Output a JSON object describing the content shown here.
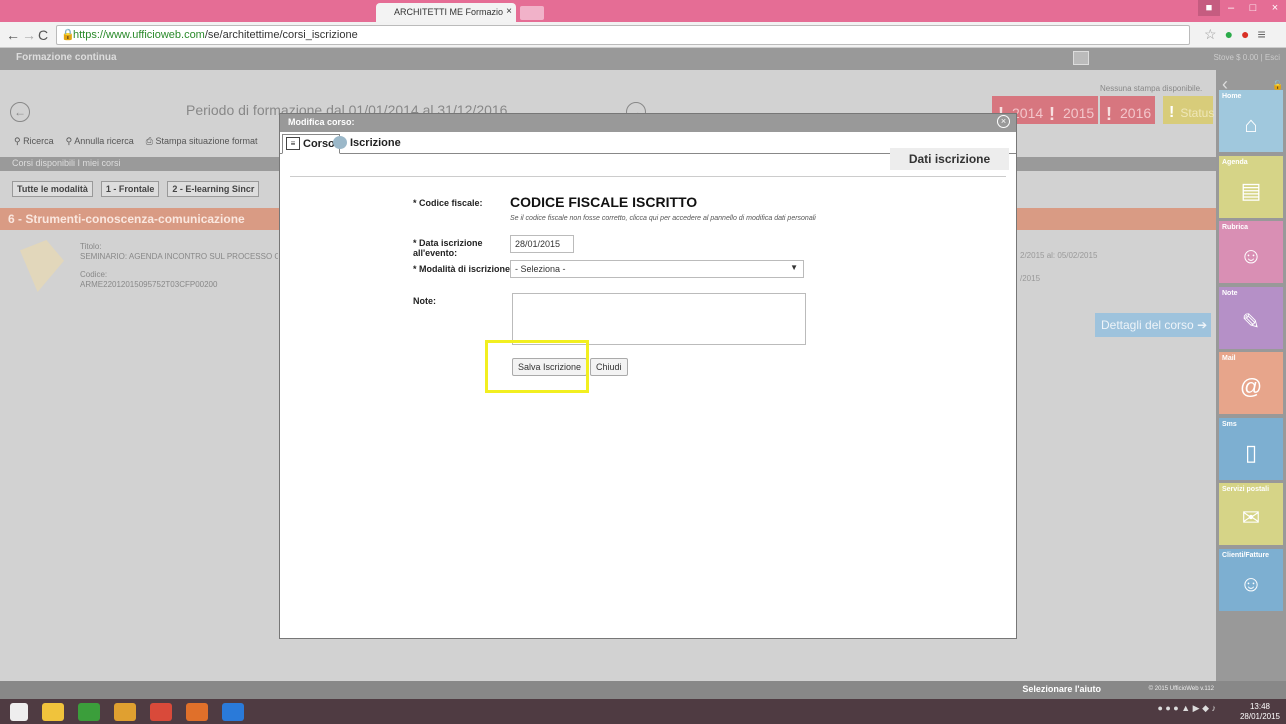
{
  "browser": {
    "tab_title": "ARCHITETTI ME Formazio",
    "url_host": "https://www.ufficioweb.com",
    "url_path": "/se/architettime/corsi_iscrizione"
  },
  "app": {
    "title": "Formazione continua",
    "top_right": "Stove $ 0.00 | Esci",
    "period": "Periodo di formazione dal 01/01/2014 al 31/12/2016",
    "no_print": "Nessuna stampa disponibile.",
    "years": [
      "2014",
      "2015",
      "2016"
    ],
    "status": "Status",
    "toolbar": [
      "Ricerca",
      "Annulla ricerca",
      "Stampa situazione format"
    ],
    "tabs_row": "Corsi disponibili  I miei corsi",
    "modalities": [
      "Tutte le modalità",
      "1 - Frontale",
      "2 - E-learning Sincr"
    ],
    "category": "6 - Strumenti-conoscenza-comunicazione",
    "course": {
      "titolo_label": "Titolo:",
      "titolo": "SEMINARIO: AGENDA INCONTRO SUL PROCESSO CIVILE",
      "codice_label": "Codice:",
      "codice": "ARME22012015095752T03CFP00200"
    },
    "right_info": [
      "2/2015 al: 05/02/2015",
      "/2015"
    ],
    "dettagli": "Dettagli del corso"
  },
  "sidebar": {
    "tiles": [
      {
        "label": "Home",
        "icon": "home-icon",
        "color": "#a0c8dd"
      },
      {
        "label": "Agenda",
        "icon": "agenda-icon",
        "color": "#d6d487"
      },
      {
        "label": "Rubrica",
        "icon": "contacts-icon",
        "color": "#d98fb4"
      },
      {
        "label": "Note",
        "icon": "note-icon",
        "color": "#b590c7"
      },
      {
        "label": "Mail",
        "icon": "mail-icon",
        "color": "#e7a58b"
      },
      {
        "label": "Sms",
        "icon": "phone-icon",
        "color": "#7dafd1"
      },
      {
        "label": "Servizi postali",
        "icon": "envelope-icon",
        "color": "#d6d487"
      },
      {
        "label": "Clienti/Fatture",
        "icon": "clients-icon",
        "color": "#7dafd1"
      }
    ]
  },
  "bottom": {
    "help": "Selezionare l'aiuto",
    "copyright": "© 2015 UfficioWeb  v.112"
  },
  "taskbar": {
    "time": "13:48",
    "date": "28/01/2015"
  },
  "modal": {
    "title": "Modifica corso:",
    "tab_corso": "Corso",
    "tab_iscrizione": "Iscrizione",
    "section": "Dati iscrizione",
    "cf_label": "* Codice fiscale:",
    "cf_value": "CODICE FISCALE ISCRITTO",
    "cf_note": "Se il codice fiscale non fosse corretto, clicca qui per accedere al pannello di modifica dati personali",
    "date_label": "* Data iscrizione all'evento:",
    "date_value": "28/01/2015",
    "mod_label": "* Modalità di iscrizione:",
    "mod_value": "- Seleziona -",
    "note_label": "Note:",
    "note_value": "",
    "save": "Salva Iscrizione",
    "close": "Chiudi"
  }
}
